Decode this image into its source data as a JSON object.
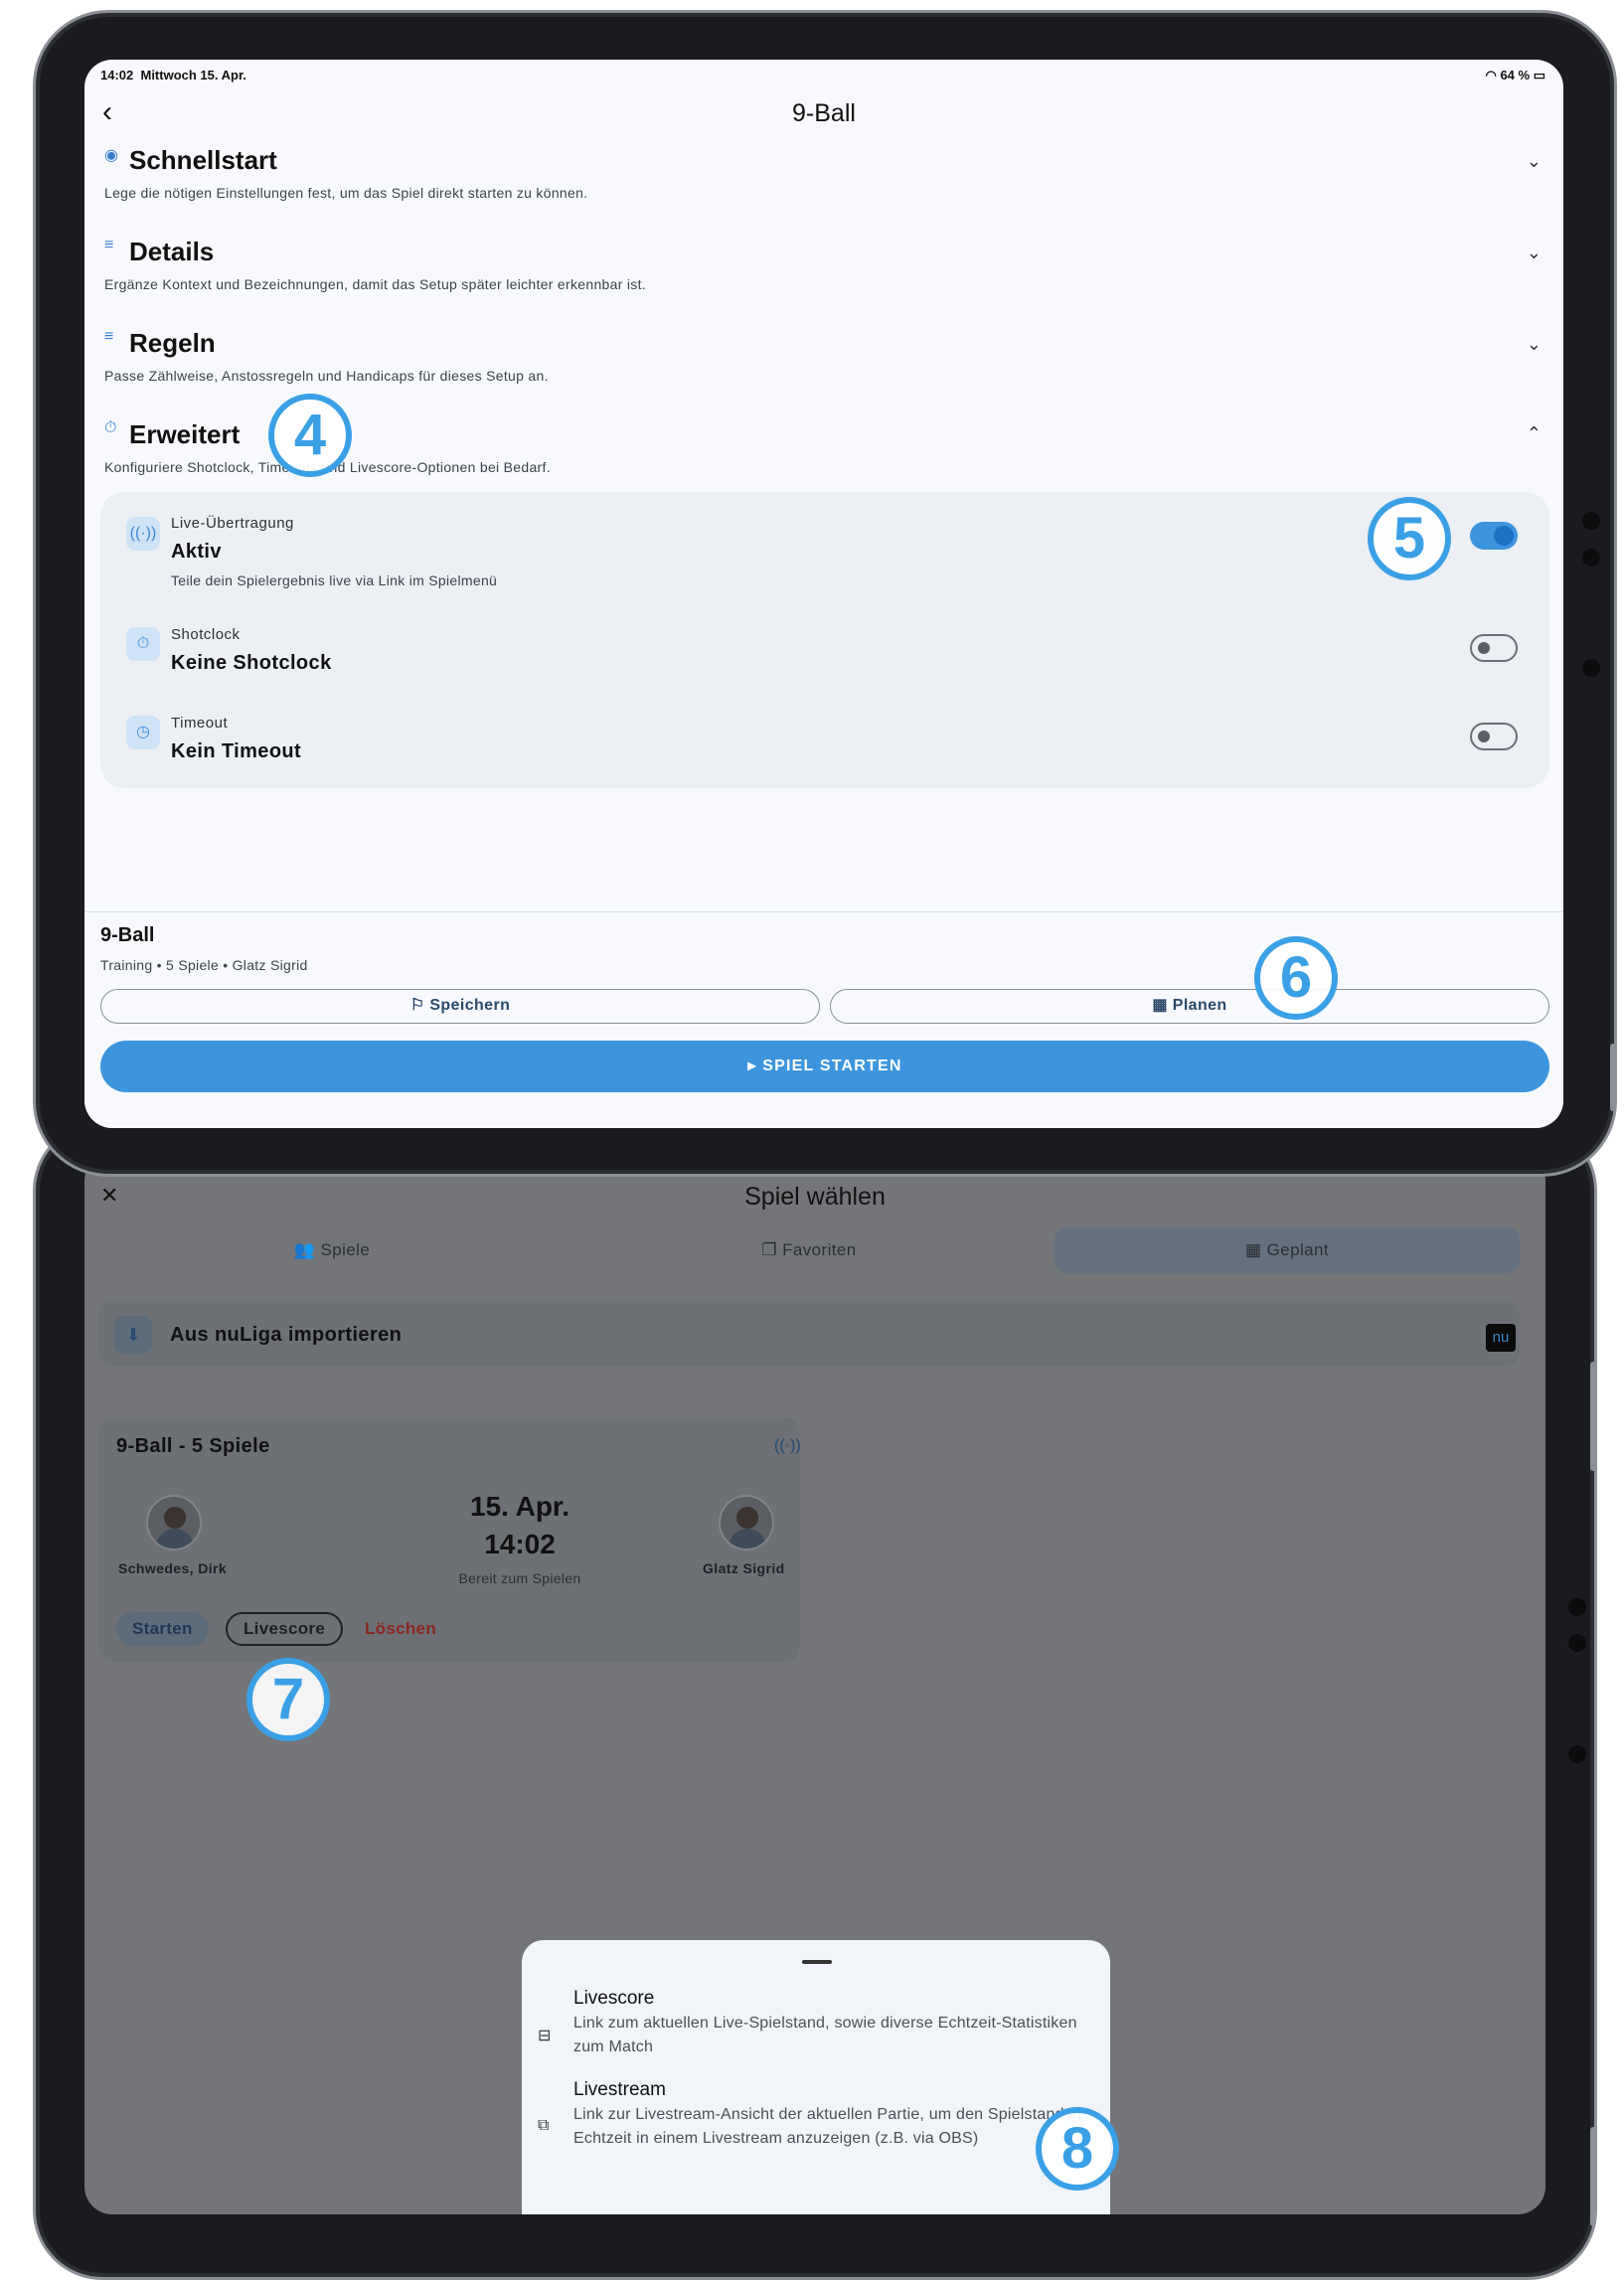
{
  "status_bar": {
    "time": "14:02",
    "date": "Mittwoch 15. Apr.",
    "battery": "64 %"
  },
  "setup": {
    "title": "9-Ball",
    "sections": [
      {
        "icon": "quickstart-icon",
        "title": "Schnellstart",
        "subtitle": "Lege die nötigen Einstellungen fest, um das Spiel direkt starten zu können.",
        "expanded": false
      },
      {
        "icon": "details-icon",
        "title": "Details",
        "subtitle": "Ergänze Kontext und Bezeichnungen, damit das Setup später leichter erkennbar ist.",
        "expanded": false
      },
      {
        "icon": "rules-icon",
        "title": "Regeln",
        "subtitle": "Passe Zählweise, Anstossregeln und Handicaps für dieses Setup an.",
        "expanded": false
      },
      {
        "icon": "timer-icon",
        "title": "Erweitert",
        "subtitle": "Konfiguriere Shotclock, Timeouts und Livescore-Optionen bei Bedarf.",
        "expanded": true
      }
    ],
    "advanced": [
      {
        "icon": "broadcast-icon",
        "label": "Live-Übertragung",
        "value": "Aktiv",
        "description": "Teile dein Spielergebnis live via Link im Spielmenü",
        "enabled": true
      },
      {
        "icon": "stopwatch-icon",
        "label": "Shotclock",
        "value": "Keine Shotclock",
        "enabled": false
      },
      {
        "icon": "clock-icon",
        "label": "Timeout",
        "value": "Kein Timeout",
        "enabled": false
      }
    ],
    "footer": {
      "title": "9-Ball",
      "subtitle": "Training • 5 Spiele • Glatz Sigrid",
      "save_label": "Speichern",
      "plan_label": "Planen",
      "start_label": "SPIEL STARTEN"
    }
  },
  "chooser": {
    "title": "Spiel wählen",
    "tabs": [
      {
        "label": "Spiele",
        "active": false
      },
      {
        "label": "Favoriten",
        "active": false
      },
      {
        "label": "Geplant",
        "active": true
      }
    ],
    "import_label": "Aus nuLiga importieren",
    "import_logo": "nu",
    "match": {
      "title": "9-Ball - 5 Spiele",
      "player1": "Schwedes, Dirk",
      "player2": "Glatz Sigrid",
      "date": "15. Apr.",
      "time": "14:02",
      "status": "Bereit zum Spielen",
      "actions": {
        "start": "Starten",
        "livescore": "Livescore",
        "delete": "Löschen"
      }
    },
    "sheet": [
      {
        "icon": "scoreboard-icon",
        "title": "Livescore",
        "description": "Link zum aktuellen Live-Spielstand, sowie diverse Echtzeit-Statistiken zum Match"
      },
      {
        "icon": "tv-icon",
        "title": "Livestream",
        "description": "Link zur Livestream-Ansicht der aktuellen Partie, um den Spielstand in Echtzeit in einem Livestream anzuzeigen (z.B. via OBS)"
      }
    ]
  },
  "callouts": [
    "4",
    "5",
    "6",
    "7",
    "8"
  ],
  "colors": {
    "accent": "#3d95dd",
    "callout": "#3aa0e6",
    "delete": "#8c2620"
  }
}
